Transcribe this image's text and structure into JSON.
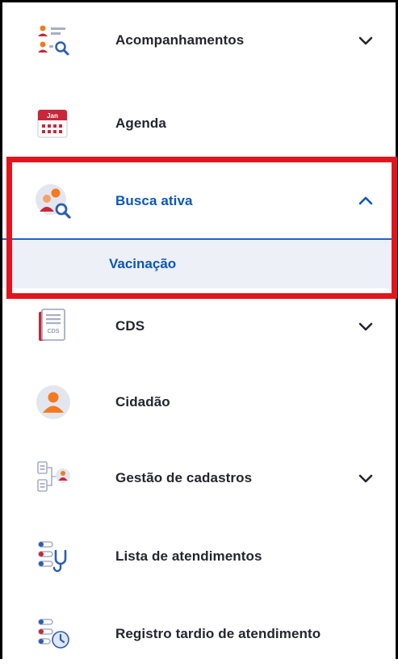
{
  "menu": {
    "items": [
      {
        "label": "Acompanhamentos",
        "icon": "monitoring-icon",
        "expandable": true
      },
      {
        "label": "Agenda",
        "icon": "calendar-icon",
        "calendar_month": "Jan",
        "expandable": false
      },
      {
        "label": "Busca ativa",
        "icon": "user-search-icon",
        "expandable": true,
        "expanded": true
      },
      {
        "label": "CDS",
        "icon": "cds-form-icon",
        "form_text": "CDS",
        "expandable": true
      },
      {
        "label": "Cidadão",
        "icon": "citizen-icon",
        "expandable": false
      },
      {
        "label": "Gestão de cadastros",
        "icon": "registry-management-icon",
        "expandable": true
      },
      {
        "label": "Lista de atendimentos",
        "icon": "care-list-icon",
        "expandable": false
      },
      {
        "label": "Registro tardio de atendimento",
        "icon": "late-record-icon",
        "expandable": false
      }
    ],
    "submenu": {
      "parent": "Busca ativa",
      "items": [
        {
          "label": "Vacinação"
        }
      ]
    }
  },
  "colors": {
    "text": "#24252e",
    "active": "#0b57b5",
    "submenu_bg": "#eef0f7",
    "highlight": "#e2141d",
    "icon_red": "#c8273a",
    "icon_orange": "#f47a1f",
    "icon_blue": "#2b5fae"
  }
}
